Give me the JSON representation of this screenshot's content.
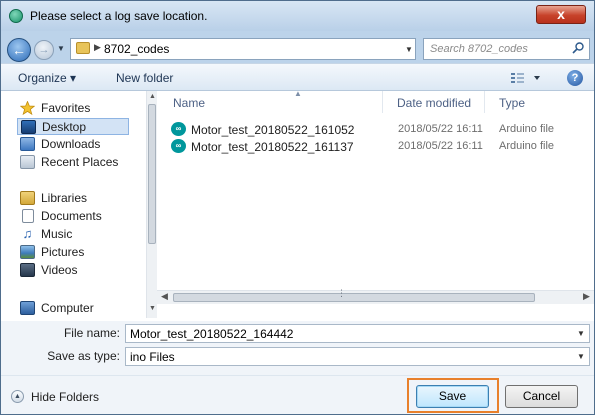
{
  "window": {
    "title": "Please select a log save location.",
    "close_label": "x"
  },
  "address_bar": {
    "breadcrumb": "8702_codes",
    "search_placeholder": "Search 8702_codes"
  },
  "toolbar": {
    "organize_label": "Organize ▾",
    "new_folder_label": "New folder",
    "help_label": "?"
  },
  "nav": {
    "favorites_label": "Favorites",
    "favorites": [
      {
        "label": "Desktop",
        "icon": "desktop-icon"
      },
      {
        "label": "Downloads",
        "icon": "downloads-icon"
      },
      {
        "label": "Recent Places",
        "icon": "recent-places-icon"
      }
    ],
    "libraries_label": "Libraries",
    "libraries": [
      {
        "label": "Documents",
        "icon": "documents-icon"
      },
      {
        "label": "Music",
        "icon": "music-icon"
      },
      {
        "label": "Pictures",
        "icon": "pictures-icon"
      },
      {
        "label": "Videos",
        "icon": "videos-icon"
      }
    ],
    "computer_label": "Computer",
    "selected": "Desktop"
  },
  "files": {
    "columns": [
      "Name",
      "Date modified",
      "Type"
    ],
    "rows": [
      {
        "name": "Motor_test_20180522_161052",
        "date": "2018/05/22 16:11",
        "type": "Arduino file"
      },
      {
        "name": "Motor_test_20180522_161137",
        "date": "2018/05/22 16:11",
        "type": "Arduino file"
      }
    ]
  },
  "fields": {
    "file_name_label": "File name:",
    "file_name_value": "Motor_test_20180522_164442",
    "save_as_type_label": "Save as type:",
    "save_as_type_value": "ino Files"
  },
  "footer": {
    "hide_folders_label": "Hide Folders",
    "save_label": "Save",
    "cancel_label": "Cancel",
    "highlight_color": "#e8802c"
  }
}
